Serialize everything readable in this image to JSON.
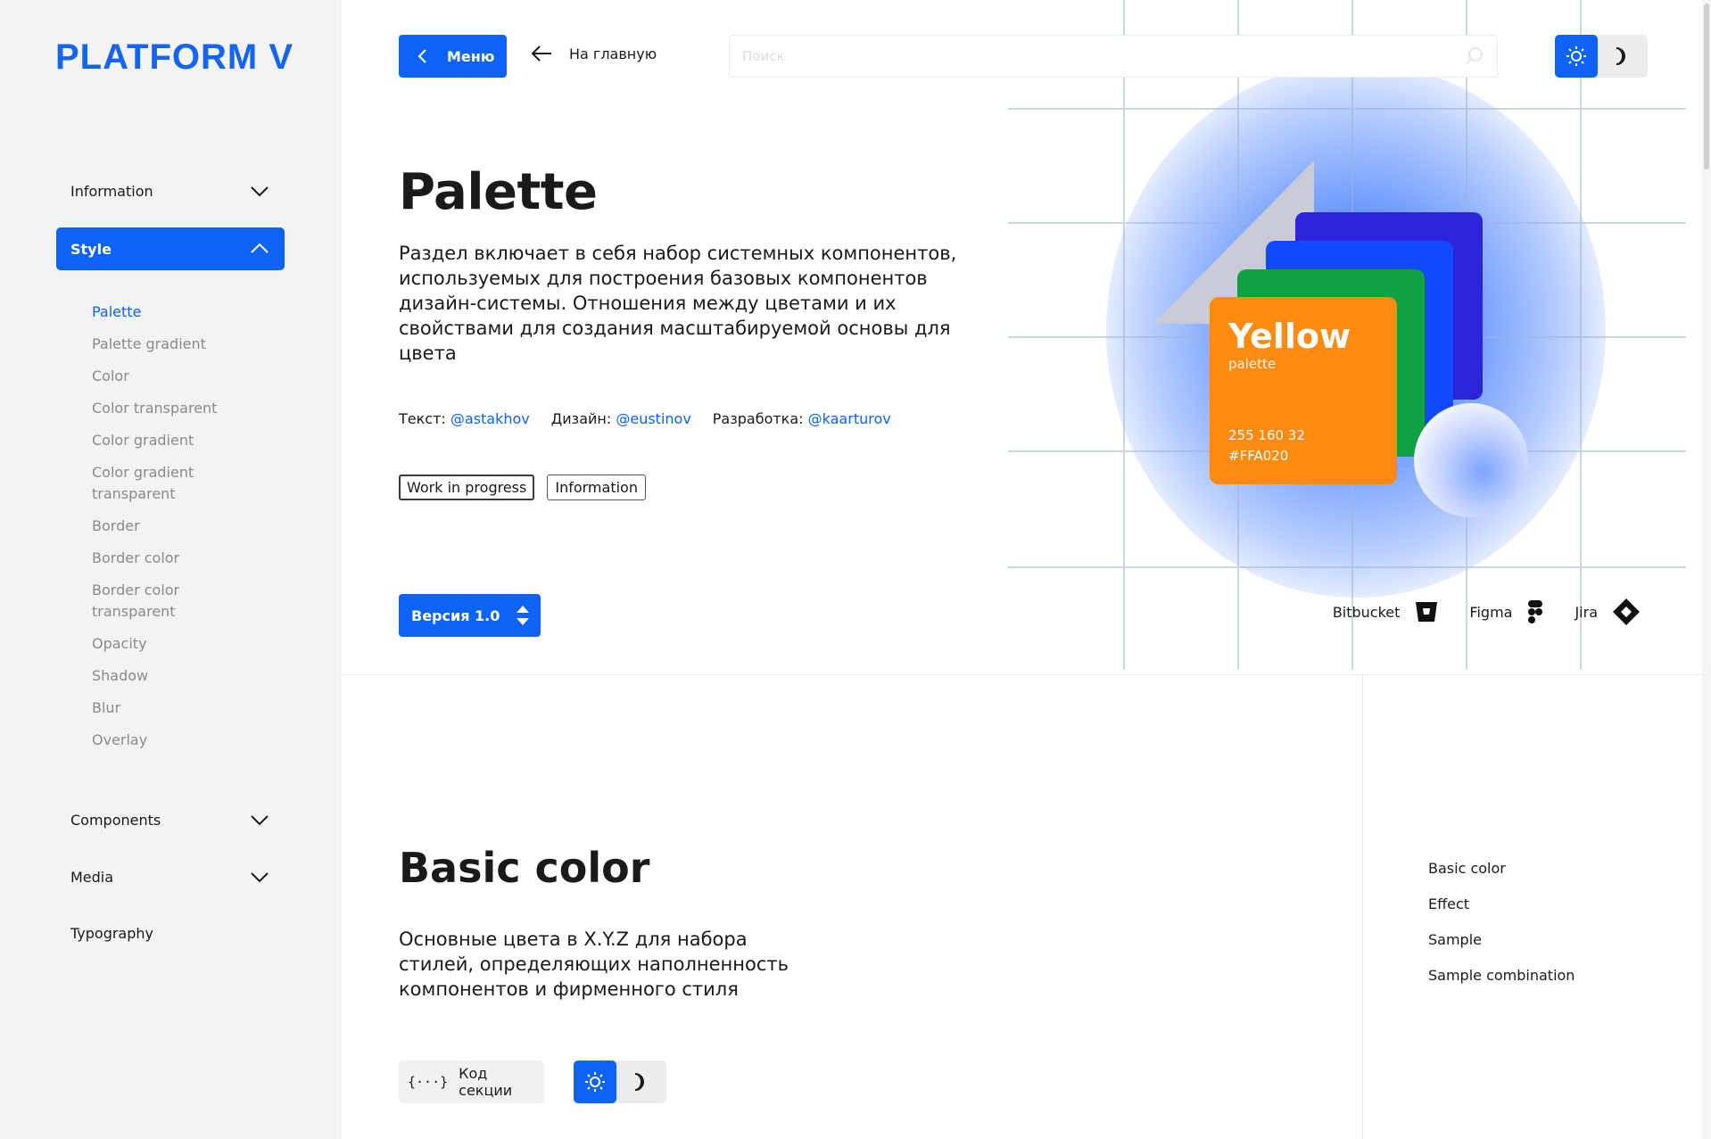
{
  "brand": {
    "logo": "PLATFORM V",
    "accent": "#0d63f6"
  },
  "sidebar": {
    "groups": [
      {
        "label": "Information",
        "expanded": false
      },
      {
        "label": "Style",
        "expanded": true
      },
      {
        "label": "Components",
        "expanded": false
      },
      {
        "label": "Media",
        "expanded": false
      }
    ],
    "style_items": [
      "Palette",
      "Palette gradient",
      "Color",
      "Color transparent",
      "Color gradient",
      "Color gradient\ntransparent",
      "Border",
      "Border color",
      "Border color\ntransparent",
      "Opacity",
      "Shadow",
      "Blur",
      "Overlay"
    ],
    "current_item": "Palette",
    "typography": "Typography"
  },
  "topbar": {
    "menu_label": "Меню",
    "home_label": "На главную",
    "search_placeholder": "Поиск",
    "theme": "light"
  },
  "hero": {
    "title": "Palette",
    "description": "Раздел включает в себя набор системных компонентов, используемых для построения базовых компонентов дизайн-системы. Отношения между цветами и их свойствами для создания масштабируемой основы для цвета",
    "credits": [
      {
        "role": "Текст:",
        "user": "@astakhov"
      },
      {
        "role": "Дизайн:",
        "user": "@eustinov"
      },
      {
        "role": "Разработка:",
        "user": "@kaarturov"
      }
    ],
    "tags": [
      "Work in progress",
      "Information"
    ],
    "version_label": "Версия 1.0",
    "links": [
      "Bitbucket",
      "Figma",
      "Jira"
    ],
    "card": {
      "title": "Yellow",
      "subtitle": "palette",
      "rgb": "255 160 32",
      "hex": "#FFA020"
    },
    "card_colors": [
      "#2b24d8",
      "#1249ff",
      "#0fa243",
      "#ff8a12"
    ]
  },
  "basic_color": {
    "title": "Basic color",
    "description": "Основные цвета в X.Y.Z для набора стилей, определяющих наполненность компонентов и фирменного стиля",
    "code_label": "Код секции"
  },
  "toc": [
    "Basic color",
    "Effect",
    "Sample",
    "Sample combination"
  ],
  "icons": [
    "chevron-left-icon",
    "arrow-left-icon",
    "search-icon",
    "sun-icon",
    "moon-icon",
    "chevron-down-icon",
    "chevron-up-icon",
    "sort-arrows-icon",
    "bitbucket-icon",
    "figma-icon",
    "jira-icon",
    "code-braces-icon"
  ]
}
